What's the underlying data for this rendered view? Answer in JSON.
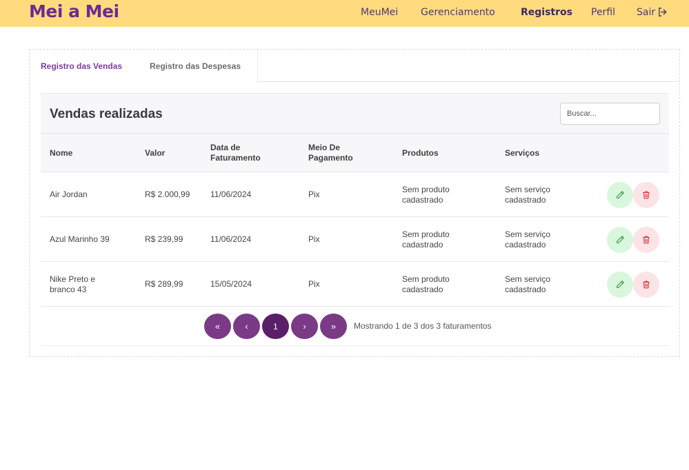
{
  "navbar": {
    "brand": "Mei a Mei",
    "links": [
      {
        "label": "MeuMei"
      },
      {
        "label": "Gerenciamento"
      },
      {
        "label": "Registros"
      },
      {
        "label": "Perfil"
      },
      {
        "label": "Sair"
      }
    ]
  },
  "tabs": [
    {
      "label": "Registro das Vendas"
    },
    {
      "label": "Registro das Despesas"
    }
  ],
  "panel": {
    "title": "Vendas realizadas",
    "search_placeholder": "Buscar..."
  },
  "table": {
    "headers": {
      "nome": "Nome",
      "valor": "Valor",
      "data_l1": "Data de",
      "data_l2": "Faturamento",
      "meio_l1": "Meio De",
      "meio_l2": "Pagamento",
      "produtos": "Produtos",
      "servicos": "Serviços"
    },
    "rows": [
      {
        "nome_l1": "Air Jordan",
        "nome_l2": "",
        "valor": "R$ 2.000,99",
        "data": "11/06/2024",
        "meio": "Pix",
        "produtos_l1": "Sem produto",
        "produtos_l2": "cadastrado",
        "servicos_l1": "Sem serviço",
        "servicos_l2": "cadastrado"
      },
      {
        "nome_l1": "Azul Marinho 39",
        "nome_l2": "",
        "valor": "R$ 239,99",
        "data": "11/06/2024",
        "meio": "Pix",
        "produtos_l1": "Sem produto",
        "produtos_l2": "cadastrado",
        "servicos_l1": "Sem serviço",
        "servicos_l2": "cadastrado"
      },
      {
        "nome_l1": "Nike Preto e",
        "nome_l2": "branco 43",
        "valor": "R$ 289,99",
        "data": "15/05/2024",
        "meio": "Pix",
        "produtos_l1": "Sem produto",
        "produtos_l2": "cadastrado",
        "servicos_l1": "Sem serviço",
        "servicos_l2": "cadastrado"
      }
    ]
  },
  "pagination": {
    "first": "«",
    "prev": "‹",
    "current": "1",
    "next": "›",
    "last": "»",
    "info": "Mostrando 1 de 3 dos 3 faturamentos"
  },
  "colors": {
    "navbar_bg": "#FFDB7E",
    "brand": "#6B2C91",
    "active_tab": "#7d3aa6",
    "pagination": "#7a3a86",
    "edit_bg": "#d9f7dc",
    "delete_bg": "#fce4e6"
  },
  "icons": {
    "edit": "pencil-icon",
    "delete": "trash-icon",
    "logout": "logout-icon"
  }
}
